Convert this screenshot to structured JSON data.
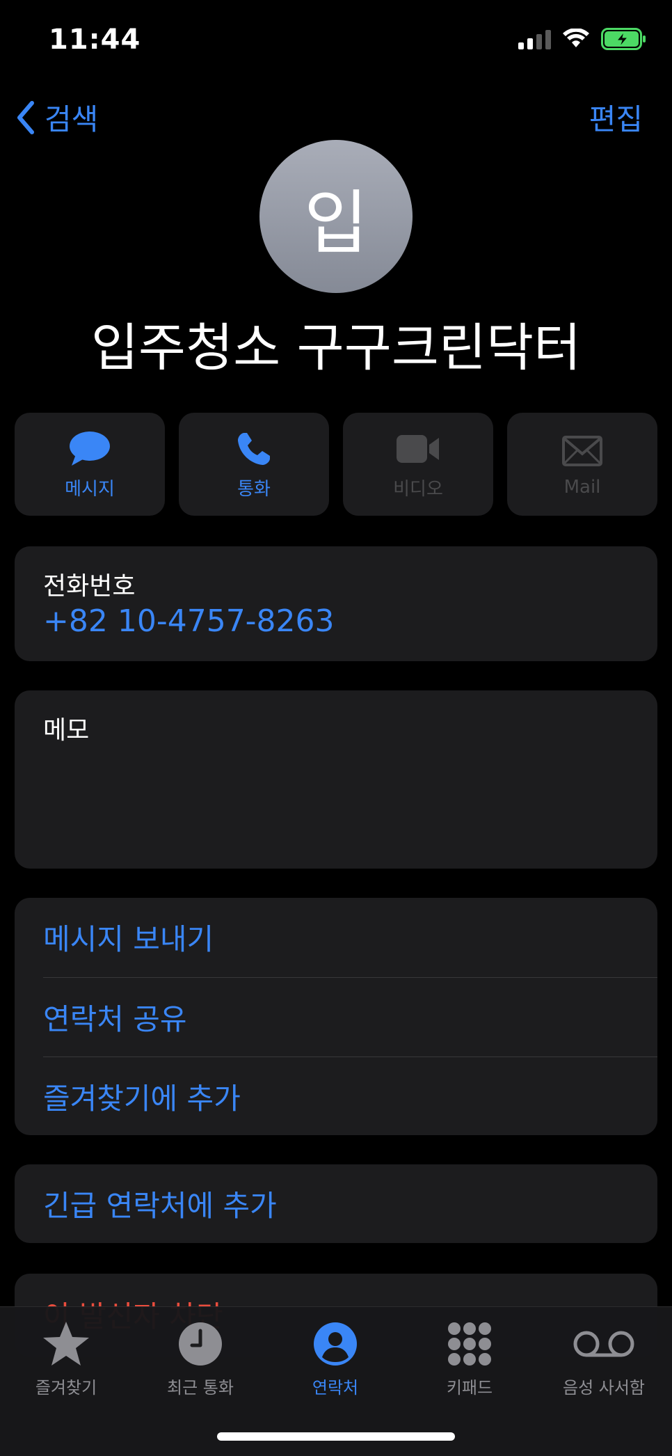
{
  "status_bar": {
    "time": "11:44"
  },
  "nav": {
    "back_label": "검색",
    "edit_label": "편집"
  },
  "contact": {
    "avatar_initial": "입",
    "name": "입주청소 구구크린닥터"
  },
  "actions": [
    {
      "label": "메시지",
      "icon": "message-bubble-icon",
      "enabled": true
    },
    {
      "label": "통화",
      "icon": "phone-icon",
      "enabled": true
    },
    {
      "label": "비디오",
      "icon": "video-camera-icon",
      "enabled": false
    },
    {
      "label": "Mail",
      "icon": "envelope-icon",
      "enabled": false
    }
  ],
  "phone": {
    "label": "전화번호",
    "value": "+82 10-4757-8263"
  },
  "memo": {
    "label": "메모"
  },
  "options": [
    {
      "label": "메시지 보내기"
    },
    {
      "label": "연락처 공유"
    },
    {
      "label": "즐겨찾기에 추가"
    }
  ],
  "emergency": {
    "label": "긴급 연락처에 추가"
  },
  "block": {
    "label": "이 발신자 차단"
  },
  "tabbar": {
    "tabs": [
      {
        "label": "즐겨찾기",
        "icon": "star-icon",
        "active": false
      },
      {
        "label": "최근 통화",
        "icon": "clock-icon",
        "active": false
      },
      {
        "label": "연락처",
        "icon": "person-circle-icon",
        "active": true
      },
      {
        "label": "키패드",
        "icon": "keypad-icon",
        "active": false
      },
      {
        "label": "음성 사서함",
        "icon": "voicemail-icon",
        "active": false
      }
    ]
  },
  "colors": {
    "accent": "#3a86f6",
    "destructive": "#eb4d3d",
    "card_bg": "#1c1c1e",
    "battery": "#4cd964"
  }
}
